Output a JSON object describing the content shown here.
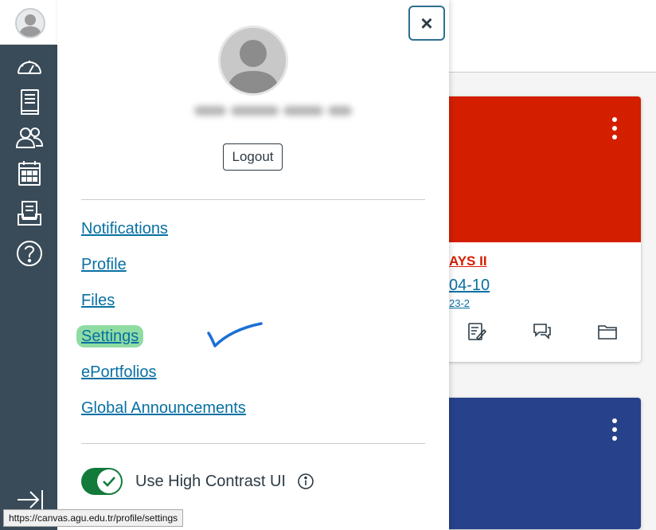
{
  "dashboard": {
    "card1": {
      "title": "AYS II",
      "code": "04-10",
      "term": "23-2",
      "color": "#d41e00"
    },
    "card2": {
      "color": "#27428a"
    }
  },
  "nav": {
    "items": [
      {
        "icon": "dashboard-icon"
      },
      {
        "icon": "courses-icon"
      },
      {
        "icon": "groups-icon"
      },
      {
        "icon": "calendar-icon"
      },
      {
        "icon": "inbox-icon"
      },
      {
        "icon": "help-icon"
      }
    ],
    "collapse_icon": "collapse-nav-icon"
  },
  "tray": {
    "close_label": "×",
    "logout_label": "Logout",
    "links": [
      "Notifications",
      "Profile",
      "Files",
      "Settings",
      "ePortfolios",
      "Global Announcements"
    ],
    "high_contrast_label": "Use High Contrast UI",
    "high_contrast_on": true
  },
  "status_url": "https://canvas.agu.edu.tr/profile/settings",
  "colors": {
    "nav_bg": "#394b58",
    "link": "#0770a3",
    "toggle_on": "#127a3a",
    "highlight": "#8fdca3",
    "annotation": "#1a6fd6"
  }
}
